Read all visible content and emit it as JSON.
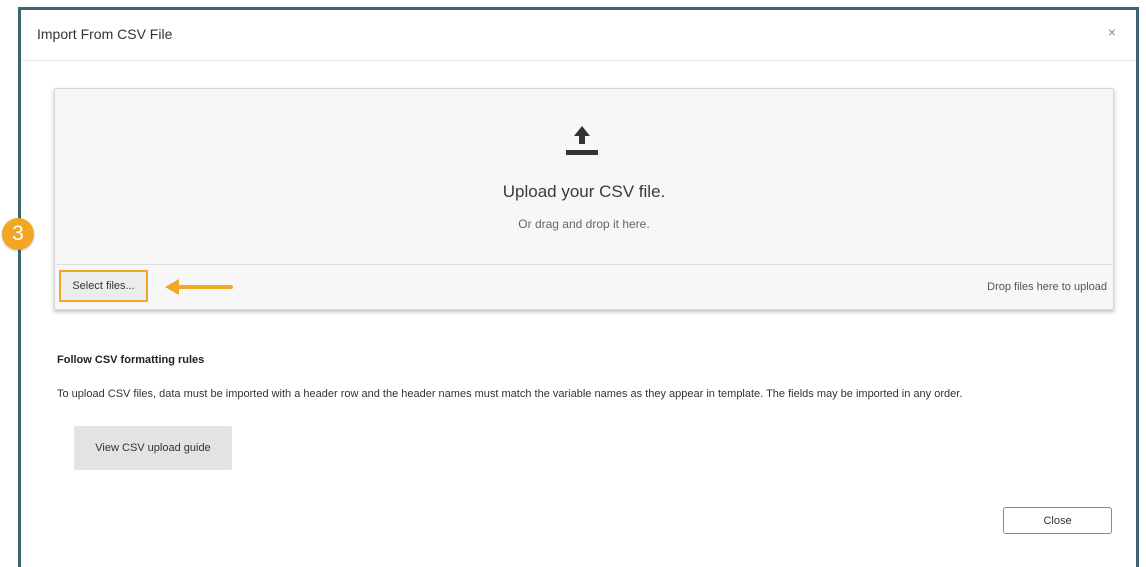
{
  "dialog": {
    "title": "Import From CSV File",
    "close_glyph": "×"
  },
  "upload": {
    "icon": "upload-icon",
    "heading": "Upload your CSV file.",
    "subheading": "Or drag and drop it here.",
    "select_label": "Select files...",
    "drop_hint": "Drop files here to upload"
  },
  "annotation": {
    "step_number": "3",
    "accent_color": "#f3a623"
  },
  "rules": {
    "title": "Follow CSV formatting rules",
    "text": "To upload CSV files, data must be imported with a header row and the header names must match the variable names as they appear in template. The fields may be imported in any order.",
    "guide_button": "View CSV upload guide"
  },
  "footer": {
    "close_label": "Close"
  }
}
